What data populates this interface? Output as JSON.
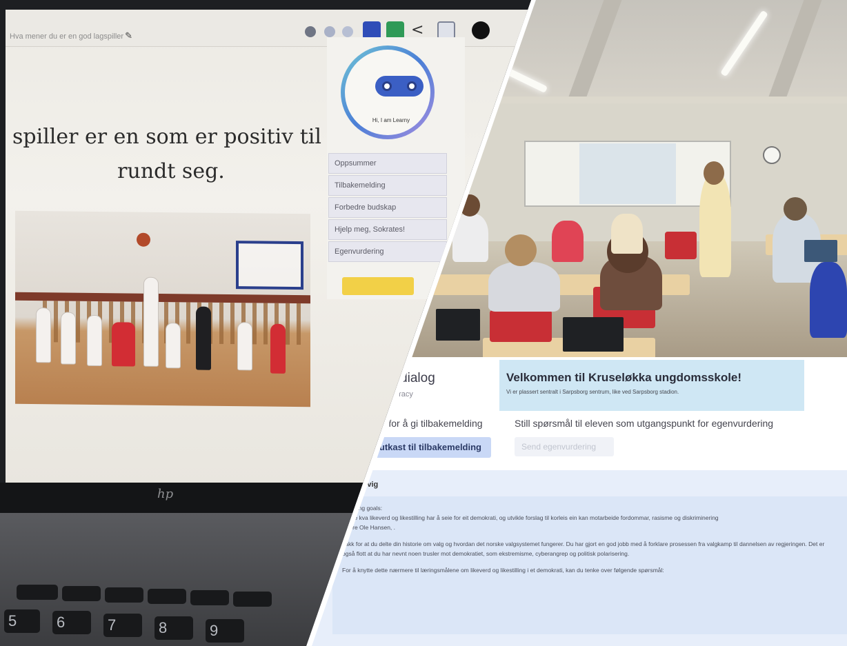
{
  "laptop": {
    "slide_title_input": "Hva mener du er en god lagspiller",
    "slide_text_line1": "spiller er en som er positiv til",
    "slide_text_line2": "rundt seg.",
    "coach": {
      "robot_caption": "Hi, I am Learny",
      "buttons": [
        "Oppsummer",
        "Tilbakemelding",
        "Forbedre budskap",
        "Hjelp meg, Sokrates!",
        "Egenvurdering"
      ]
    },
    "brand_mark": "hp",
    "keys": [
      "5",
      "6",
      "7",
      "8",
      "9"
    ]
  },
  "web": {
    "partial_title": "gsdialog",
    "partial_subtitle": "eracy",
    "welcome_title": "Velkommen til Kruseløkka ungdomsskole!",
    "welcome_subtitle": "Vi er plassert sentralt i Sarpsborg sentrum, like ved Sarpsborg stadion.",
    "left_label": "rny for å gi tilbakemelding",
    "right_label": "Still spørsmål til eleven som utgangspunkt for egenvurdering",
    "draft_button": "er utkast til tilbakemelding",
    "send_button": "Send egenvurdering",
    "feedback_name": "e Lindvig",
    "feedback_paragraphs": [
      "Learning goals:",
      "drøfte kva likeverd og likestilling har å seie for eit demokrati, og utvikle forslag til korleis ein kan motarbeide fordommar, rasisme og diskriminering",
      "Kjære Ole Hansen, .",
      "Takk for at du delte din historie om valg og hvordan det norske valgsystemet fungerer. Du har gjort en god jobb med å forklare prosessen fra valgkamp til dannelsen av regjeringen. Det er også flott at du har nevnt noen trusler mot demokratiet, som ekstremisme, cyberangrep og politisk polarisering.",
      "For å knytte dette nærmere til læringsmålene om likeverd og likestilling i et demokrati, kan du tenke over følgende spørsmål:"
    ]
  },
  "colors": {
    "robot_blue": "#3b5fc4",
    "highlight_yellow": "#f2d047",
    "welcome_bg": "#cfe7f4",
    "draft_button_bg": "#c9d8f6",
    "chair_red": "#c82f35"
  }
}
